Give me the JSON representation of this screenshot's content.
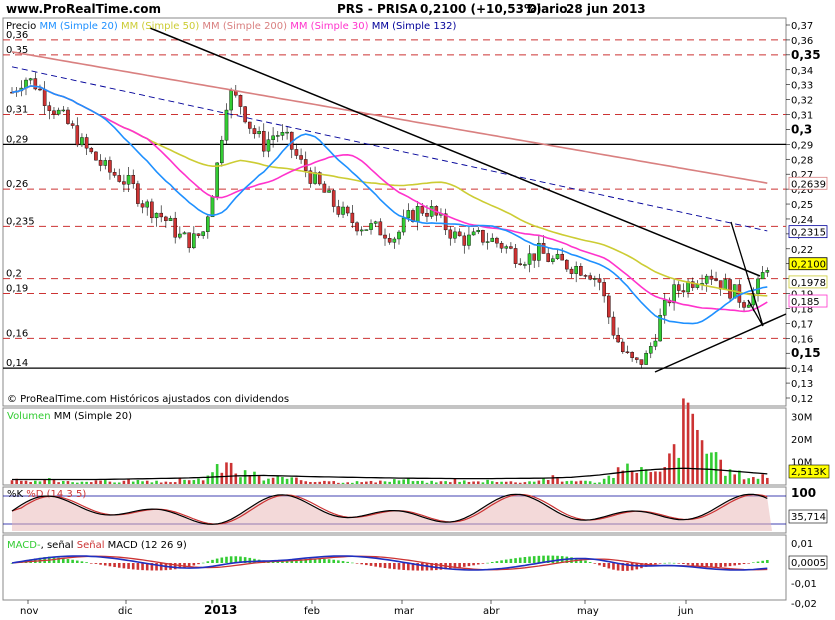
{
  "header": {
    "site": "www.ProRealTime.com",
    "title": "PRS - PRISA",
    "price": "0,2100 (+10,53%)",
    "period": "Diario",
    "date": "28 jun 2013"
  },
  "footnote": "© ProRealTime.com Históricos ajustados con dividendos",
  "colors": {
    "bull": "#33cc33",
    "bear": "#cc3333",
    "mm20": "#1e90ff",
    "mm50": "#cccc33",
    "mm200": "#d98080",
    "mm30": "#ff33cc",
    "mm132": "#000099",
    "grid_dash": "#cc3333"
  },
  "chart_data": [
    {
      "type": "candlestick",
      "legend": [
        {
          "label": "Precio",
          "color": "#000000"
        },
        {
          "label": "MM (Simple 20)",
          "color": "#1e90ff"
        },
        {
          "label": "MM (Simple 50)",
          "color": "#cccc33"
        },
        {
          "label": "MM (Simple 200)",
          "color": "#d98080"
        },
        {
          "label": "MM (Simple 30)",
          "color": "#ff33cc"
        },
        {
          "label": "MM (Simple 132)",
          "color": "#000099"
        }
      ],
      "x_labels": [
        "nov",
        "dic",
        "2013",
        "feb",
        "mar",
        "abr",
        "may",
        "jun"
      ],
      "y_ticks": [
        "0,37",
        "0,36",
        "0,35",
        "0,34",
        "0,33",
        "0,32",
        "0,31",
        "0,3",
        "0,29",
        "0,28",
        "0,27",
        "0,26",
        "0,25",
        "0,24",
        "0,23",
        "0,22",
        "0,21",
        "0,2",
        "0,19",
        "0,18",
        "0,17",
        "0,16",
        "0,15",
        "0,14",
        "0,13",
        "0,12"
      ],
      "ylim": [
        0.12,
        0.37
      ],
      "level_labels": [
        "0,36",
        "0,35",
        "0,31",
        "0,29",
        "0,26",
        "0,235",
        "0,2",
        "0,19",
        "0,16",
        "0,14"
      ],
      "current": {
        "close": "0,2100",
        "mm200": "0,2639",
        "mm132": "0,2315",
        "mm50": "0,1978",
        "mm30": "0,185"
      },
      "close_path": [
        0.325,
        0.335,
        0.33,
        0.318,
        0.31,
        0.3,
        0.288,
        0.28,
        0.272,
        0.268,
        0.262,
        0.25,
        0.245,
        0.238,
        0.228,
        0.225,
        0.232,
        0.27,
        0.325,
        0.318,
        0.3,
        0.29,
        0.298,
        0.292,
        0.278,
        0.268,
        0.258,
        0.248,
        0.24,
        0.236,
        0.234,
        0.232,
        0.228,
        0.24,
        0.247,
        0.245,
        0.236,
        0.228,
        0.226,
        0.228,
        0.226,
        0.222,
        0.216,
        0.214,
        0.218,
        0.212,
        0.21,
        0.208,
        0.206,
        0.198,
        0.168,
        0.15,
        0.142,
        0.148,
        0.172,
        0.19,
        0.195,
        0.2,
        0.205,
        0.198,
        0.192,
        0.185,
        0.19,
        0.21
      ]
    },
    {
      "type": "bar",
      "title": "Volumen MM (Simple 20)",
      "y_ticks": [
        "30M",
        "20M",
        "10M"
      ],
      "current": "2,513K",
      "values": [
        2,
        1,
        1,
        2,
        1,
        1,
        1,
        2,
        1,
        1,
        2,
        1,
        1,
        1,
        2,
        1,
        3,
        6,
        9,
        4,
        5,
        2,
        3,
        2,
        2,
        1,
        2,
        1,
        1,
        1,
        1,
        1,
        2,
        2,
        1,
        1,
        1,
        2,
        1,
        1,
        2,
        1,
        1,
        1,
        2,
        3,
        1,
        2,
        1,
        1,
        4,
        6,
        9,
        5,
        4,
        12,
        28,
        30,
        14,
        8,
        5,
        4,
        3,
        4
      ]
    },
    {
      "type": "line",
      "title": "%K %D (14 3 5)",
      "y_ticks": [
        "100"
      ],
      "current": "35,714"
    },
    {
      "type": "bar",
      "title": "MACD-, señal Señal MACD (12 26 9)",
      "y_ticks": [
        "0,01",
        "0",
        "-0,01",
        "-0,02"
      ],
      "current": "0,0005"
    }
  ]
}
